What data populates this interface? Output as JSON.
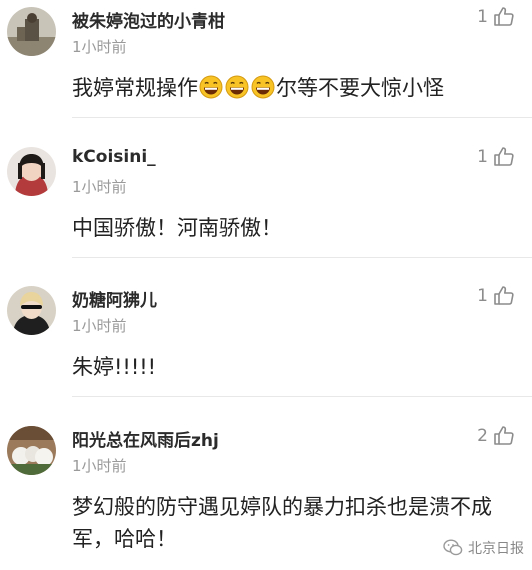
{
  "comments": [
    {
      "username": "被朱婷泡过的小青柑",
      "time": "1小时前",
      "likes": "1",
      "text_before_emoji": "我婷常规操作",
      "emoji_name": "grinning-face-emoji",
      "emoji_count": 3,
      "text_after_emoji": "尔等不要大惊小怪"
    },
    {
      "username": "kCoisini_",
      "time": "1小时前",
      "likes": "1",
      "text": "中国骄傲！河南骄傲！"
    },
    {
      "username": "奶糖阿狒儿",
      "time": "1小时前",
      "likes": "1",
      "text": "朱婷!!!!!"
    },
    {
      "username": "阳光总在风雨后zhj",
      "time": "1小时前",
      "likes": "2",
      "text": "梦幻般的防守遇见婷队的暴力扣杀也是溃不成军，哈哈！"
    }
  ],
  "watermark": {
    "icon": "wechat-icon",
    "label": "北京日报"
  },
  "colors": {
    "username": "#2b2b2b",
    "meta": "#9a9a9a",
    "divider": "#e8e8e8"
  }
}
